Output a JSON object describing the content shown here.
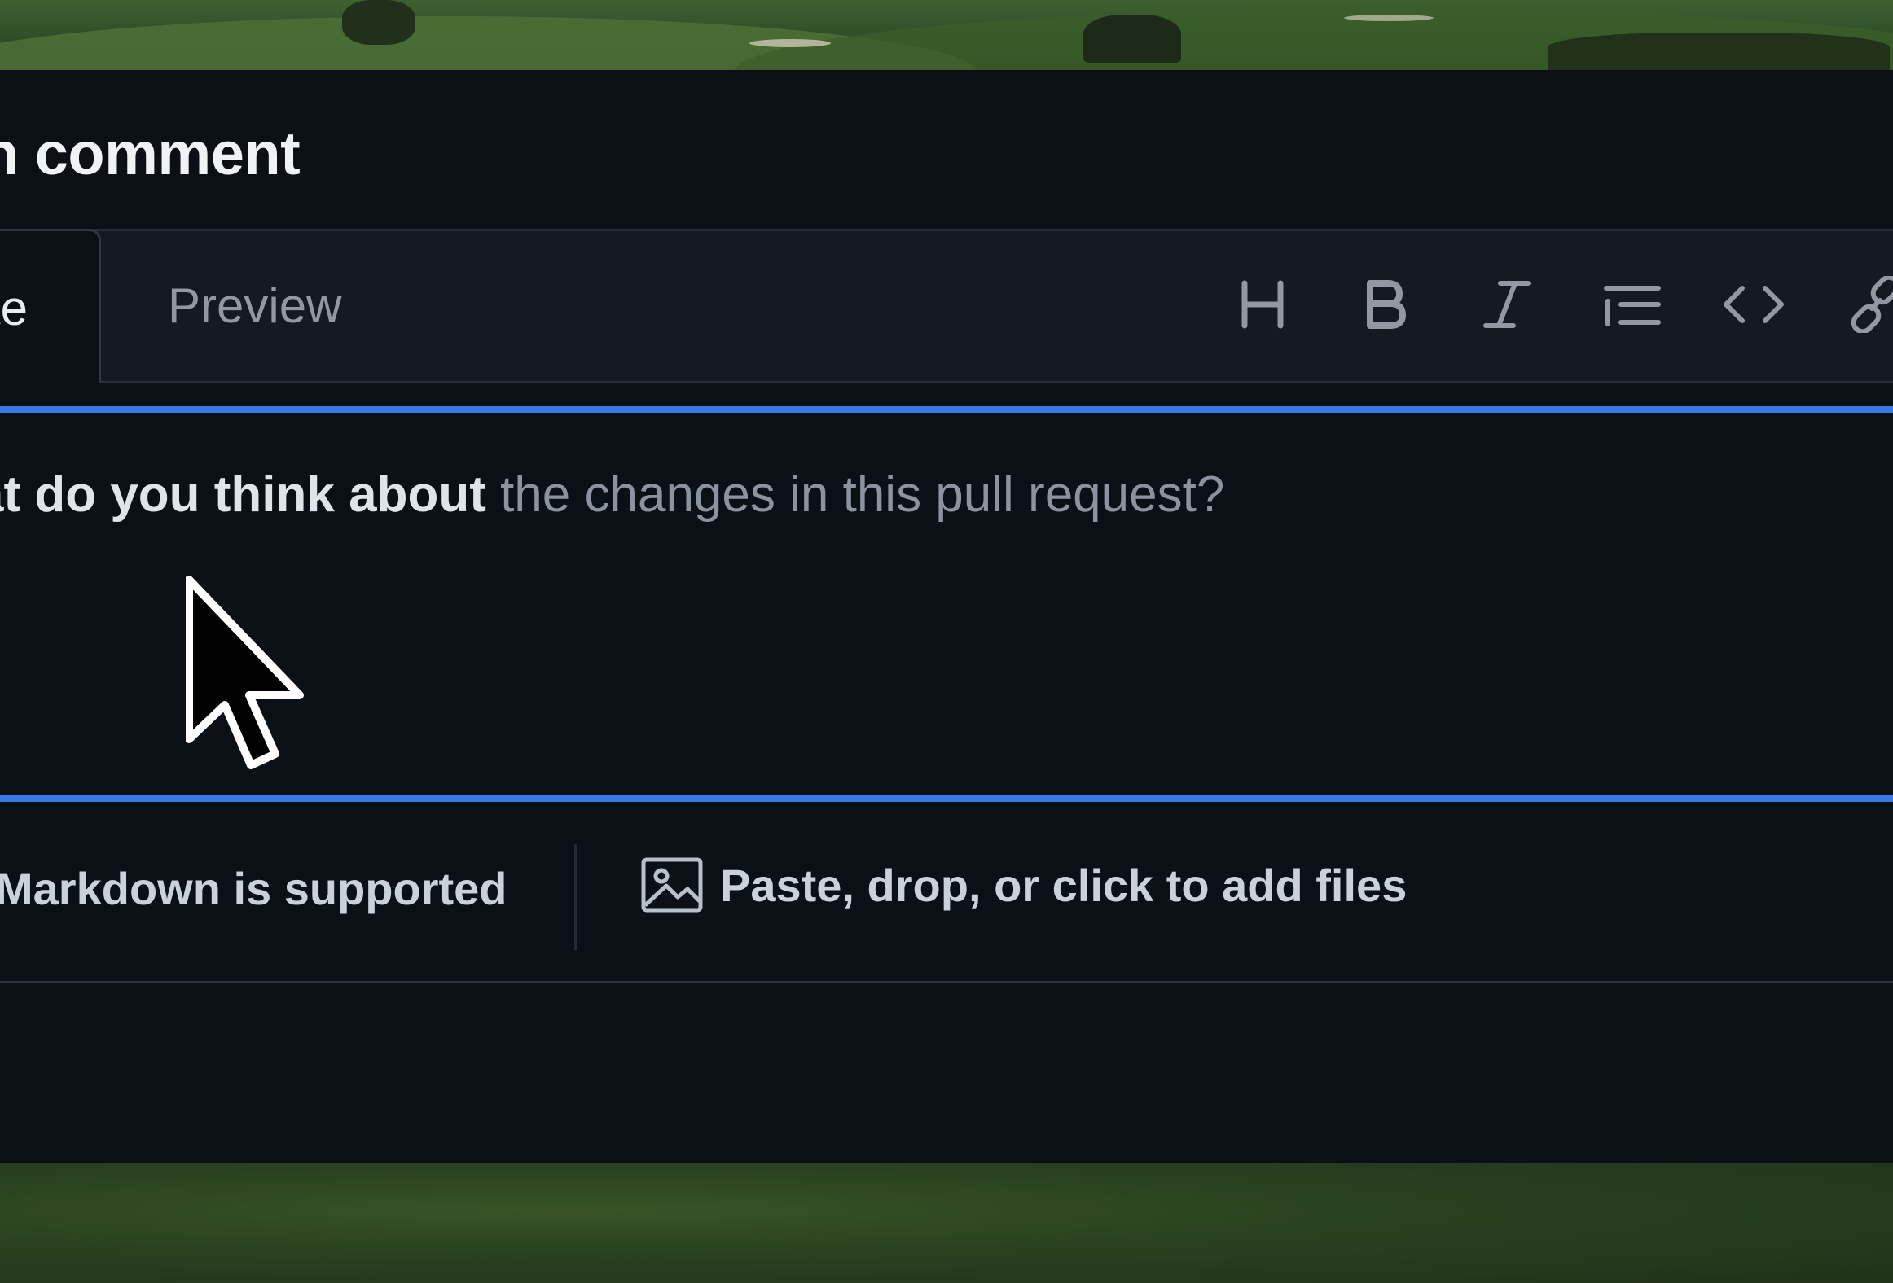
{
  "dialog": {
    "title": "n comment"
  },
  "tabs": {
    "write_label": "te",
    "preview_label": "Preview"
  },
  "toolbar": {
    "heading_label": "H",
    "bold_label": "B",
    "italic_label": "I",
    "icons": [
      "heading-icon",
      "bold-icon",
      "italic-icon",
      "ordered-list-icon",
      "code-icon",
      "link-icon"
    ]
  },
  "editor": {
    "placeholder_strong": "at do you think about",
    "placeholder_muted": " the changes in this pull request?"
  },
  "footer": {
    "markdown_label": "Markdown is supported",
    "attach_label": "Paste, drop, or click to add files"
  },
  "colors": {
    "focus_border": "#3b79e6",
    "panel_bg": "#0b0f16",
    "toolbar_bg": "#141922"
  }
}
